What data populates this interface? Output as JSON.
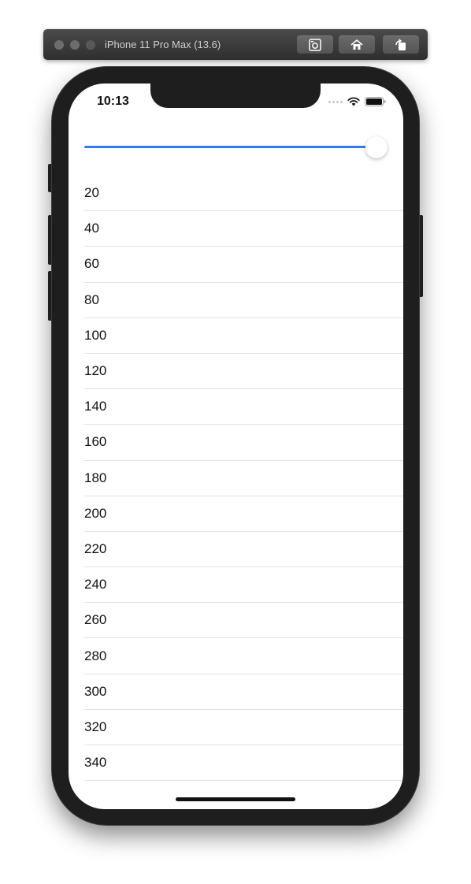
{
  "simulator": {
    "title": "iPhone 11 Pro Max (13.6)",
    "buttons": [
      {
        "name": "screenshot",
        "icon": "camera-icon"
      },
      {
        "name": "home",
        "icon": "home-icon"
      },
      {
        "name": "rotate",
        "icon": "rotate-icon"
      }
    ]
  },
  "status_bar": {
    "time": "10:13",
    "icons": [
      "signal-dots-icon",
      "wifi-icon",
      "battery-icon"
    ]
  },
  "slider": {
    "value_fraction": 1.0,
    "accent_color": "#3478f6"
  },
  "list": {
    "items": [
      "20",
      "40",
      "60",
      "80",
      "100",
      "120",
      "140",
      "160",
      "180",
      "200",
      "220",
      "240",
      "260",
      "280",
      "300",
      "320",
      "340"
    ]
  }
}
